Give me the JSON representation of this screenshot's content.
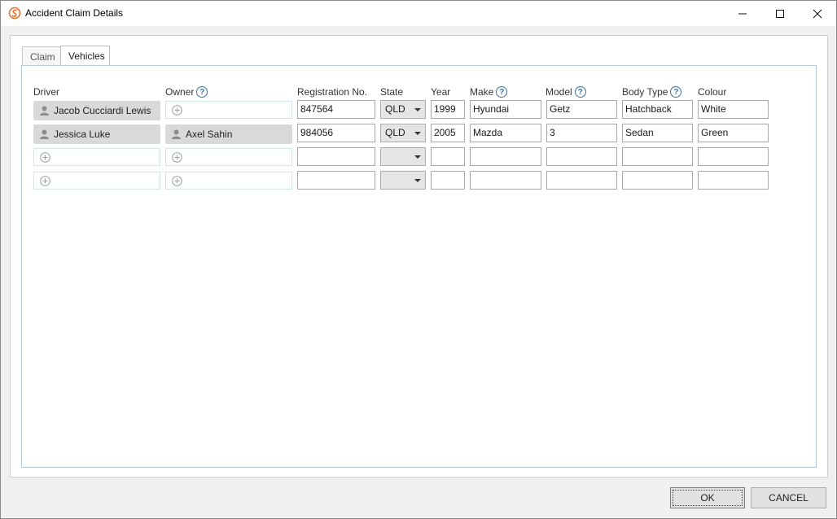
{
  "window": {
    "title": "Accident Claim Details"
  },
  "tabs": [
    {
      "label": "Claim"
    },
    {
      "label": "Vehicles"
    }
  ],
  "headers": {
    "driver": "Driver",
    "owner": "Owner",
    "registration": "Registration No.",
    "state": "State",
    "year": "Year",
    "make": "Make",
    "model": "Model",
    "body_type": "Body Type",
    "colour": "Colour"
  },
  "help_glyph": "?",
  "rows": [
    {
      "driver": "Jacob Cucciardi Lewis",
      "owner": "",
      "registration": "847564",
      "state": "QLD",
      "year": "1999",
      "make": "Hyundai",
      "model": "Getz",
      "body_type": "Hatchback",
      "colour": "White"
    },
    {
      "driver": "Jessica Luke",
      "owner": "Axel Sahin",
      "registration": "984056",
      "state": "QLD",
      "year": "2005",
      "make": "Mazda",
      "model": "3",
      "body_type": "Sedan",
      "colour": "Green"
    },
    {
      "driver": "",
      "owner": "",
      "registration": "",
      "state": "",
      "year": "",
      "make": "",
      "model": "",
      "body_type": "",
      "colour": ""
    },
    {
      "driver": "",
      "owner": "",
      "registration": "",
      "state": "",
      "year": "",
      "make": "",
      "model": "",
      "body_type": "",
      "colour": ""
    }
  ],
  "buttons": {
    "ok": "OK",
    "cancel": "CANCEL"
  },
  "colors": {
    "accent_orange": "#e8702a",
    "help_blue": "#3a74a6",
    "chip_gray": "#d9d9d9"
  },
  "icons": [
    "app-logo-icon",
    "minimize-icon",
    "maximize-icon",
    "close-icon",
    "help-icon",
    "person-icon",
    "add-circle-icon",
    "dropdown-caret-icon"
  ]
}
